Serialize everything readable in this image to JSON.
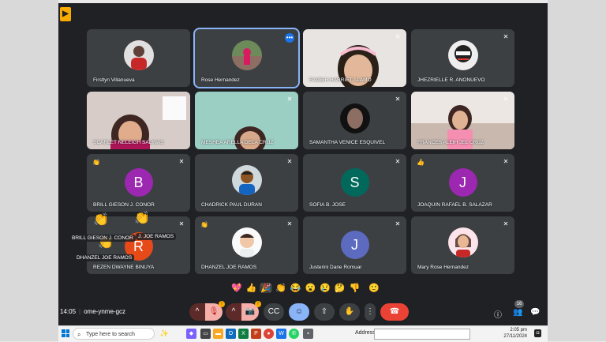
{
  "meeting": {
    "time": "14:05",
    "code": "ome-ynme-gcz",
    "participant_count": "16"
  },
  "tiles": [
    {
      "name": "Firstlyn Villanueva"
    },
    {
      "name": "Rose Hernandez"
    },
    {
      "name": "FAMEIH HARRIET ALAMO"
    },
    {
      "name": "JHEZRIELLE R. ANONUEVO"
    },
    {
      "name": "SCARLET NELEIGH SALINAS"
    },
    {
      "name": "MESHEA ARELLA DELA CRUZ"
    },
    {
      "name": "SAMANTHA VENICE ESQUIVEL"
    },
    {
      "name": "FRANCES ALEIH JEL CRUZ"
    },
    {
      "name": "BRILL GIESON J. CONOR",
      "initial": "B"
    },
    {
      "name": "CHADRICK PAUL DURAN"
    },
    {
      "name": "SOFIA B. JOSE",
      "initial": "S"
    },
    {
      "name": "JOAQUIN RAFAEL B. SALAZAR",
      "initial": "J"
    },
    {
      "name": "REZEN DWAYNE BINUYA",
      "initial": "R"
    },
    {
      "name": "DHANZEL JOE RAMOS"
    },
    {
      "name": "Justerini Dane Romuar",
      "initial": "J"
    },
    {
      "name": "Mary Rose Hernandez"
    }
  ],
  "floating_labels": {
    "one": "BRILL GIESON J. CONOR",
    "two": "DHANZEL JOE RAMOS",
    "three": "DHANZEL JOE RAMOS"
  },
  "reactions": [
    "💖",
    "👍",
    "🎉",
    "👏",
    "😂",
    "😮",
    "😢",
    "🤔",
    "👎",
    "🙂"
  ],
  "taskbar": {
    "search_placeholder": "Type here to search",
    "address_label": "Address",
    "clock_time": "2:05 pm",
    "clock_date": "27/11/2024"
  },
  "colors": {
    "meet_bg": "#202124",
    "tile_bg": "#3c4043",
    "avatar_purple": "#9c27b0",
    "avatar_teal": "#00695c",
    "avatar_indigo": "#5c6bc0",
    "leave_red": "#ea4335"
  }
}
